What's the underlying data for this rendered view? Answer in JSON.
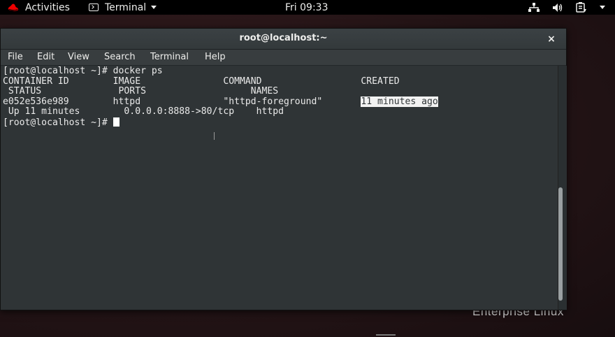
{
  "topbar": {
    "activities": "Activities",
    "app_menu": "Terminal",
    "clock": "Fri 09:33",
    "icons": [
      "network-icon",
      "volume-icon",
      "battery-icon",
      "system-menu-arrow-icon"
    ]
  },
  "desktop": {
    "watermark": "Enterprise Linux"
  },
  "window": {
    "title": "root@localhost:~",
    "close_label": "×",
    "menu": [
      "File",
      "Edit",
      "View",
      "Search",
      "Terminal",
      "Help"
    ]
  },
  "terminal": {
    "line1": "[root@localhost ~]# docker ps",
    "line2": "CONTAINER ID        IMAGE               COMMAND                  CREATED",
    "line3": " STATUS              PORTS                   NAMES",
    "line4_prefix": "e052e536e989        httpd               \"httpd-foreground\"       ",
    "line4_highlight": "11 minutes ago",
    "line5": " Up 11 minutes        0.0.0.0:8888->80/tcp    httpd",
    "line6": "[root@localhost ~]# "
  },
  "colors": {
    "terminal_bg": "#2f3436",
    "terminal_fg": "#eaeaea",
    "topbar_bg": "#000000",
    "redhat": "#ee0000"
  }
}
